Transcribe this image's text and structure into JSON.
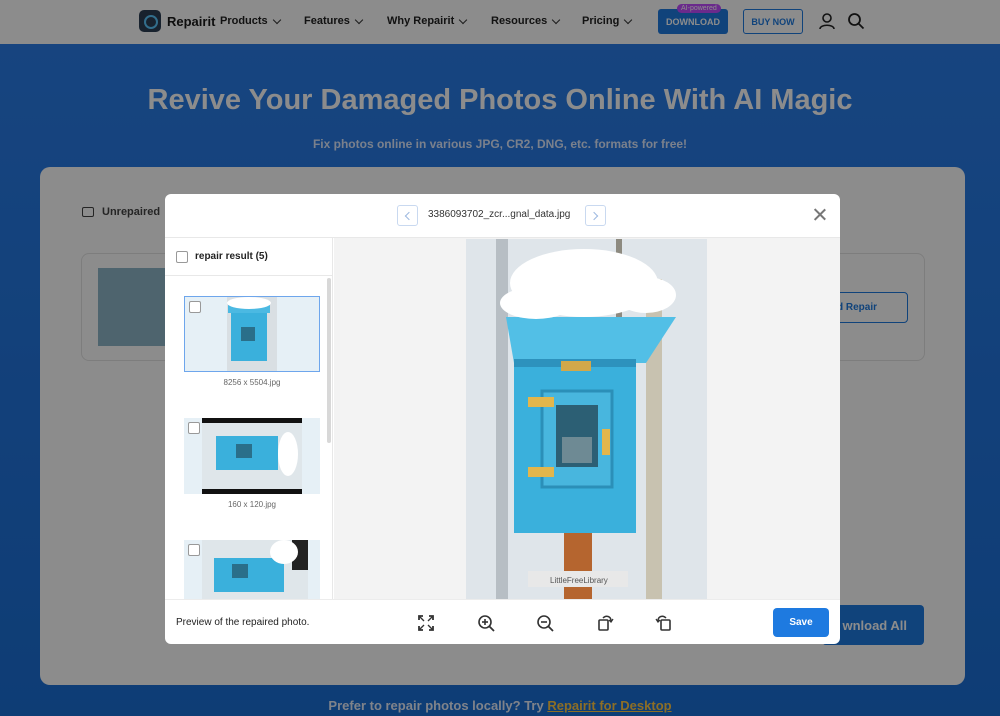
{
  "nav": {
    "brand": "Repairit",
    "items": [
      {
        "label": "Products"
      },
      {
        "label": "Features"
      },
      {
        "label": "Why Repairit"
      },
      {
        "label": "Resources"
      },
      {
        "label": "Pricing"
      }
    ],
    "ai_badge": "AI-powered",
    "download_label": "DOWNLOAD",
    "buy_label": "BUY NOW"
  },
  "hero": {
    "title": "Revive Your Damaged Photos Online With AI Magic",
    "subtitle": "Fix photos online in various JPG, CR2, DNG, etc. formats for free!"
  },
  "panel": {
    "tab_label": "Unrepaired",
    "advanced_repair_label": "d Repair",
    "download_all_label": "wnload All"
  },
  "footer": {
    "prefix": "Prefer to repair photos locally? Try ",
    "link": "Repairit for Desktop"
  },
  "modal": {
    "file_name": "3386093702_zcr...gnal_data.jpg",
    "list_title": "repair result (5)",
    "items": [
      {
        "caption": "8256 x 5504.jpg"
      },
      {
        "caption": "160 x 120.jpg"
      },
      {
        "caption": ""
      }
    ],
    "preview_text": "Preview of the repaired photo.",
    "save_label": "Save",
    "photo_sign": "LittleFreeLibrary"
  },
  "colors": {
    "accent": "#1e7ae0",
    "box_blue": "#3ab0dc"
  }
}
